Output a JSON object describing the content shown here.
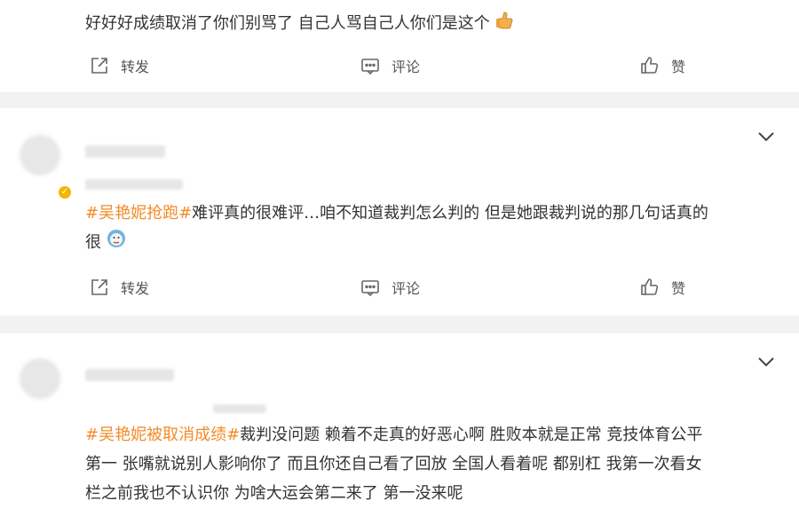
{
  "posts": [
    {
      "text": "好好好成绩取消了你们别骂了 自己人骂自己人你们是这个",
      "actions": {
        "repost": "转发",
        "comment": "评论",
        "like": "赞"
      }
    },
    {
      "tag": "#吴艳妮抢跑#",
      "text_line1": "难评真的很难评…咱不知道裁判怎么判的 但是她跟裁判说的那几句话真的",
      "text_line2": "很",
      "actions": {
        "repost": "转发",
        "comment": "评论",
        "like": "赞"
      }
    },
    {
      "tag": "#吴艳妮被取消成绩#",
      "text_line1": "裁判没问题 赖着不走真的好恶心啊 胜败本就是正常 竞技体育公平",
      "text_line2": "第一 张嘴就说别人影响你了 而且你还自己看了回放 全国人看着呢 都别杠 我第一次看女",
      "text_line3": "栏之前我也不认识你 为啥大运会第二来了 第一没来呢"
    }
  ],
  "colors": {
    "tag": "#f28c28",
    "text": "#333333",
    "icon": "#666666",
    "background": "#f2f2f2"
  }
}
